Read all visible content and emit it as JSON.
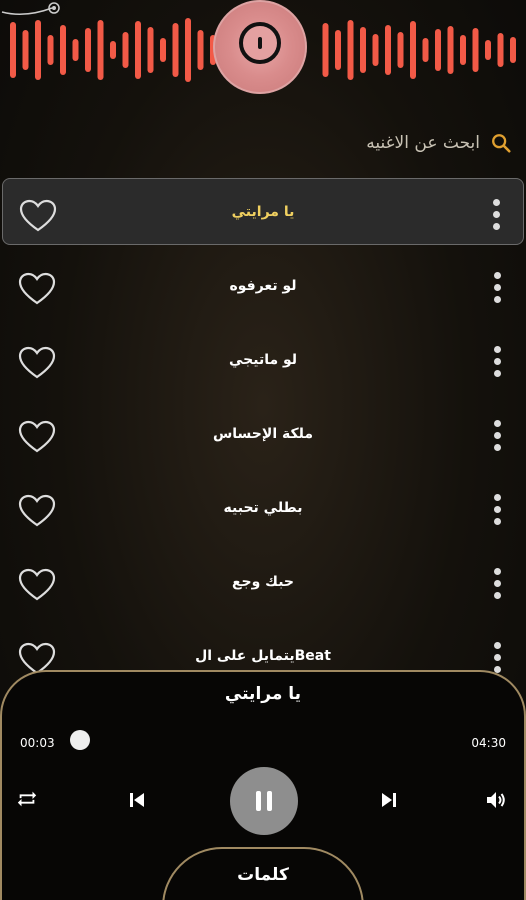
{
  "visualizer": {
    "bar_color": "#f25a47"
  },
  "search": {
    "placeholder": "ابحث عن الاغنيه",
    "icon": "search-icon",
    "icon_color": "#e0a030"
  },
  "songs": [
    {
      "title": "يا مرايتي",
      "active": true
    },
    {
      "title": "لو تعرفوه",
      "active": false
    },
    {
      "title": "لو ماتيجي",
      "active": false
    },
    {
      "title": "ملكة الإحساس",
      "active": false
    },
    {
      "title": "بطلي تحبيه",
      "active": false
    },
    {
      "title": "حبك وجع",
      "active": false
    },
    {
      "title": "يتمايل على الBeat",
      "active": false
    }
  ],
  "player": {
    "title": "يا مرايتي",
    "current_time": "00:03",
    "total_time": "04:30",
    "progress": 0.01,
    "lyrics_label": "كلمات"
  },
  "colors": {
    "active_title": "#f0d060",
    "accent_border": "#a08a62"
  }
}
